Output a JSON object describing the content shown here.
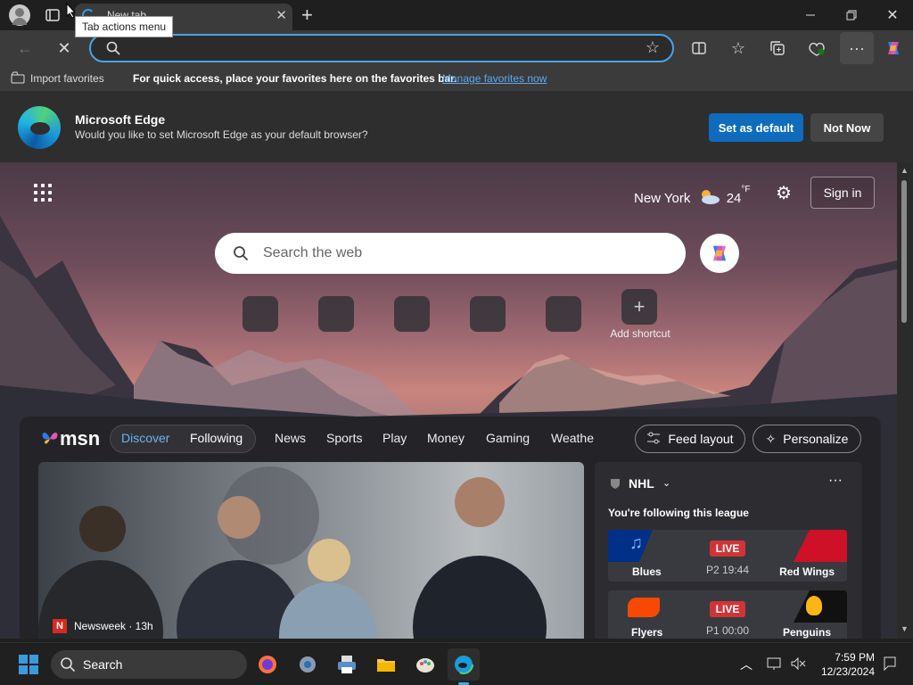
{
  "tab": {
    "title": "New tab",
    "tooltip": "Tab actions menu"
  },
  "toolbar": {
    "address_value": ""
  },
  "favorites_bar": {
    "import_label": "Import favorites",
    "message": "For quick access, place your favorites here on the favorites bar.",
    "manage_link": "Manage favorites now"
  },
  "default_banner": {
    "title": "Microsoft Edge",
    "text": "Would you like to set Microsoft Edge as your default browser?",
    "set_default": "Set as default",
    "not_now": "Not Now"
  },
  "ntp": {
    "weather_city": "New York",
    "weather_temp": "24",
    "weather_unit": "°F",
    "sign_in": "Sign in",
    "search_placeholder": "Search the web",
    "add_shortcut": "Add shortcut"
  },
  "msn": {
    "logo": "msn",
    "tabs": [
      "Discover",
      "Following"
    ],
    "nav": [
      "News",
      "Sports",
      "Play",
      "Money",
      "Gaming",
      "Weathe"
    ],
    "feed_layout": "Feed layout",
    "personalize": "Personalize",
    "hero_source": "Newsweek · 13h",
    "nhl": {
      "title": "NHL",
      "following": "You're following this league",
      "games": [
        {
          "home": "Blues",
          "away": "Red Wings",
          "status": "LIVE",
          "period": "P2 19:44"
        },
        {
          "home": "Flyers",
          "away": "Penguins",
          "status": "LIVE",
          "period": "P1 00:00"
        }
      ]
    }
  },
  "taskbar": {
    "search": "Search",
    "time": "7:59 PM",
    "date": "12/23/2024"
  },
  "colors": {
    "accent": "#0f6cbd",
    "live": "#d13438",
    "focus": "#4aa3e8"
  }
}
